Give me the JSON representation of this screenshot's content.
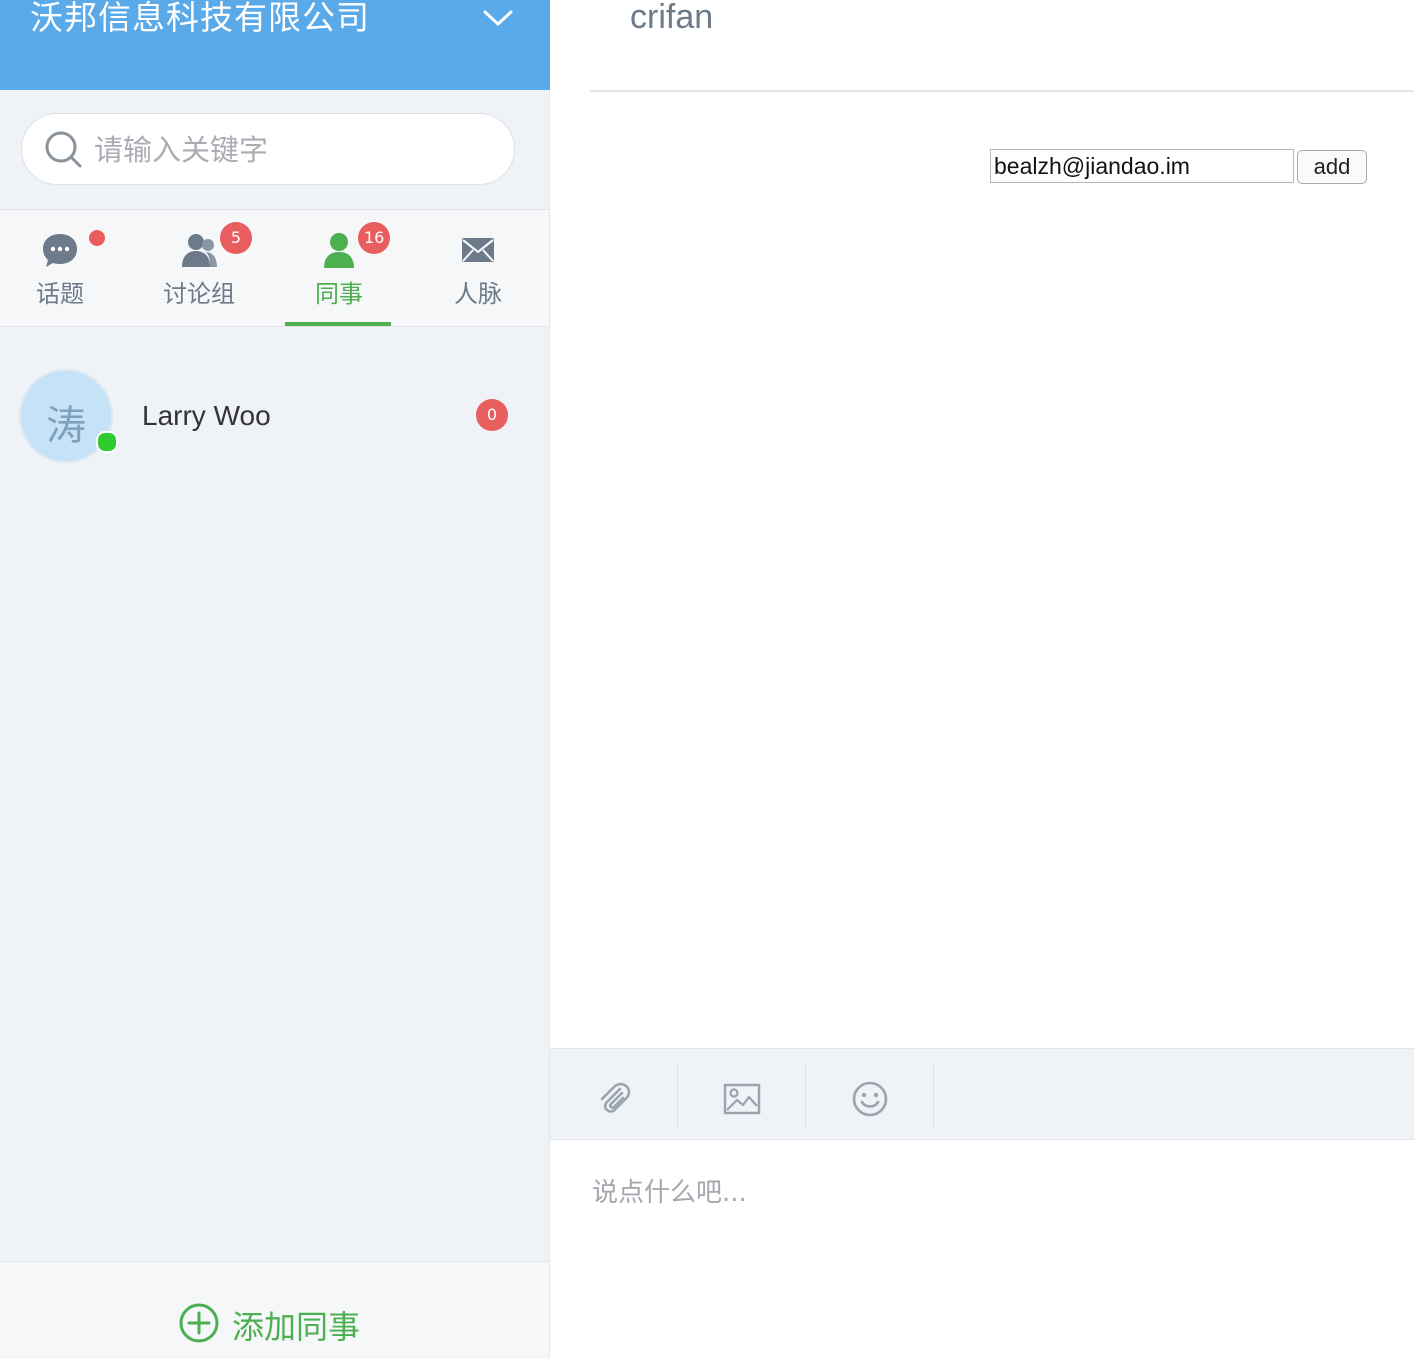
{
  "sidebar": {
    "org_name": "沃邦信息科技有限公司",
    "search": {
      "placeholder": "请输入关键字",
      "value": ""
    },
    "tabs": [
      {
        "label": "话题",
        "icon": "chat-bubble-icon",
        "badge": "",
        "dot": true
      },
      {
        "label": "讨论组",
        "icon": "group-icon",
        "badge": "5"
      },
      {
        "label": "同事",
        "icon": "person-icon",
        "badge": "16",
        "active": true
      },
      {
        "label": "人脉",
        "icon": "envelope-icon",
        "badge": ""
      }
    ],
    "contacts": [
      {
        "name": "Larry Woo",
        "avatar_char": "涛",
        "online": true,
        "unread": "0"
      }
    ],
    "add_colleague_label": "添加同事"
  },
  "main": {
    "title": "crifan",
    "email_input": {
      "value": "bealzh@jiandao.im"
    },
    "add_button_label": "add",
    "toolbar": [
      "paperclip-icon",
      "image-icon",
      "smiley-icon"
    ],
    "message_placeholder": "说点什么吧..."
  },
  "colors": {
    "header_blue": "#5aa9e8",
    "accent_green": "#4caf50",
    "badge_red": "#e85d5d",
    "online_green": "#2ecc2e"
  }
}
